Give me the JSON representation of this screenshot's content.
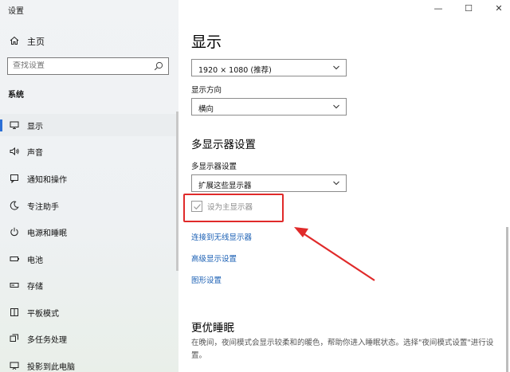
{
  "window": {
    "title": "设置",
    "minimize": "—",
    "maximize": "☐",
    "close": "✕"
  },
  "sidebar": {
    "home_label": "主页",
    "search_placeholder": "查找设置",
    "section_label": "系统",
    "items": [
      {
        "label": "显示",
        "icon": "monitor-icon",
        "active": true
      },
      {
        "label": "声音",
        "icon": "speaker-icon"
      },
      {
        "label": "通知和操作",
        "icon": "notification-icon"
      },
      {
        "label": "专注助手",
        "icon": "moon-icon"
      },
      {
        "label": "电源和睡眠",
        "icon": "power-icon"
      },
      {
        "label": "电池",
        "icon": "battery-icon"
      },
      {
        "label": "存储",
        "icon": "storage-icon"
      },
      {
        "label": "平板模式",
        "icon": "tablet-icon"
      },
      {
        "label": "多任务处理",
        "icon": "multitask-icon"
      },
      {
        "label": "投影到此电脑",
        "icon": "project-icon"
      }
    ]
  },
  "main": {
    "title": "显示",
    "resolution_value": "1920 × 1080 (推荐)",
    "orientation_label": "显示方向",
    "orientation_value": "横向",
    "multi_display_title": "多显示器设置",
    "multi_display_label": "多显示器设置",
    "multi_display_value": "扩展这些显示器",
    "primary_checkbox_label": "设为主显示器",
    "links": {
      "wireless": "连接到无线显示器",
      "advanced": "高级显示设置",
      "graphics": "图形设置"
    },
    "sleep_title": "更优睡眠",
    "sleep_desc": "在晚间，夜间模式会显示较柔和的暖色，帮助你进入睡眠状态。选择\"夜间模式设置\"进行设置。"
  },
  "colors": {
    "accent": "#2b6fd6",
    "link": "#1a5fb4",
    "highlight": "#e02a2a"
  }
}
